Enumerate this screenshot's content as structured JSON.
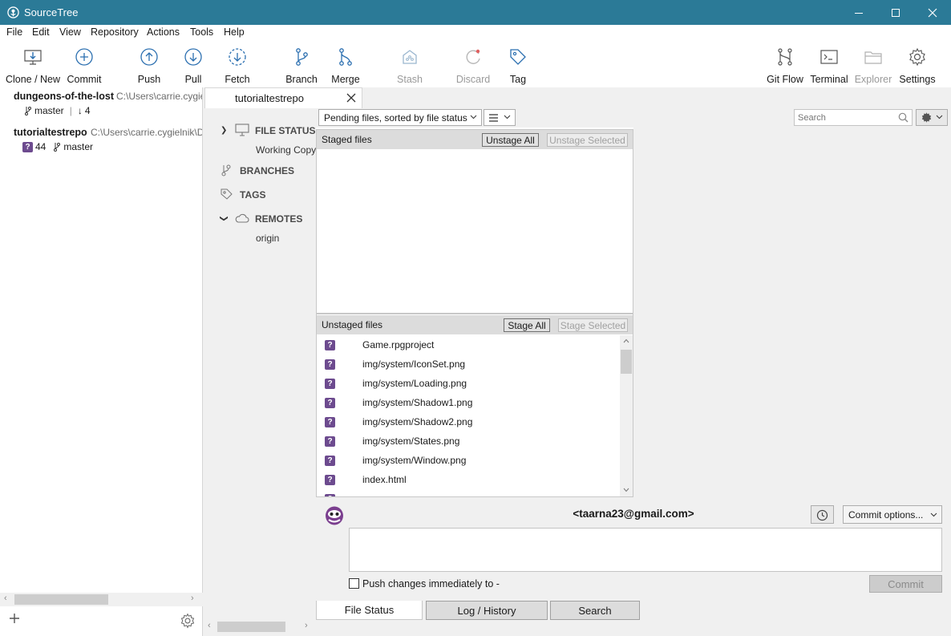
{
  "window": {
    "title": "SourceTree"
  },
  "menu": [
    "File",
    "Edit",
    "View",
    "Repository",
    "Actions",
    "Tools",
    "Help"
  ],
  "toolbar": {
    "clone": "Clone / New",
    "commit": "Commit",
    "push": "Push",
    "pull": "Pull",
    "fetch": "Fetch",
    "branch": "Branch",
    "merge": "Merge",
    "stash": "Stash",
    "discard": "Discard",
    "tag": "Tag",
    "gitflow": "Git Flow",
    "terminal": "Terminal",
    "explorer": "Explorer",
    "settings": "Settings"
  },
  "repos": [
    {
      "name": "dungeons-of-the-lost",
      "path": "C:\\Users\\carrie.cygielnik",
      "branch": "master",
      "behind": "4"
    },
    {
      "name": "tutorialtestrepo",
      "path": "C:\\Users\\carrie.cygielnik\\D",
      "badge": "44",
      "branch": "master"
    }
  ],
  "tab": {
    "label": "tutorialtestrepo"
  },
  "sidebar": {
    "file_status": "FILE STATUS",
    "working_copy": "Working Copy",
    "branches": "BRANCHES",
    "tags": "TAGS",
    "remotes": "REMOTES",
    "origin": "origin"
  },
  "filter": {
    "label": "Pending files, sorted by file status",
    "search_placeholder": "Search"
  },
  "staged": {
    "title": "Staged files",
    "unstage_all": "Unstage All",
    "unstage_selected": "Unstage Selected"
  },
  "unstaged": {
    "title": "Unstaged files",
    "stage_all": "Stage All",
    "stage_selected": "Stage Selected",
    "files": [
      "Game.rpgproject",
      "img/system/IconSet.png",
      "img/system/Loading.png",
      "img/system/Shadow1.png",
      "img/system/Shadow2.png",
      "img/system/States.png",
      "img/system/Window.png",
      "index.html"
    ]
  },
  "commit": {
    "author": "<taarna23@gmail.com>",
    "options": "Commit options...",
    "push_label": "Push changes immediately to -",
    "button": "Commit"
  },
  "bottom_tabs": [
    "File Status",
    "Log / History",
    "Search"
  ],
  "colors": {
    "titlebar": "#2b7a97",
    "accent": "#2b6fb0",
    "untracked_badge": "#6d4b8f"
  }
}
